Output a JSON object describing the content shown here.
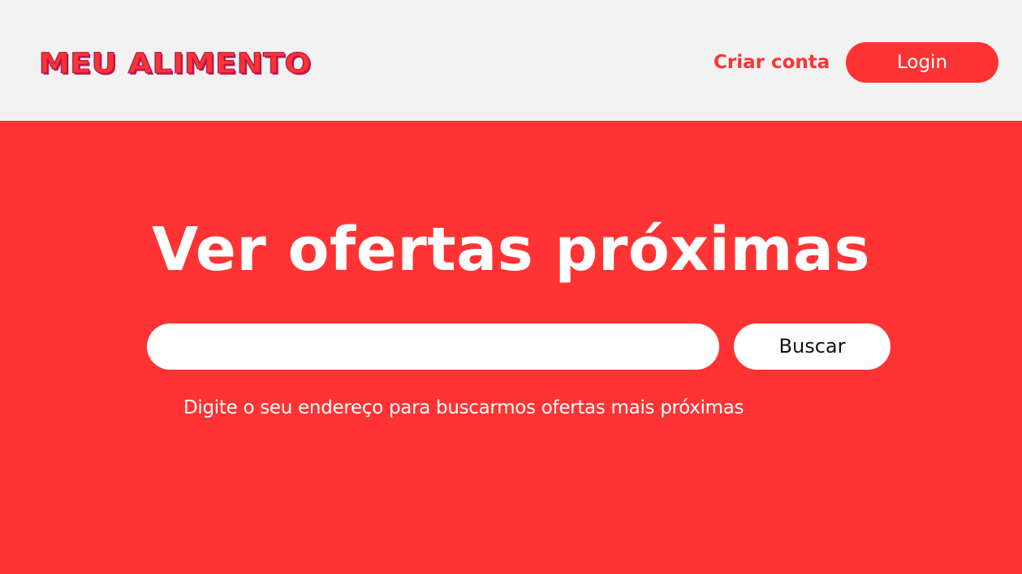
{
  "header": {
    "logo_text": "MEU ALIMENTO",
    "signup_label": "Criar conta",
    "login_label": "Login"
  },
  "hero": {
    "headline": "Ver ofertas próximas",
    "search": {
      "value": "",
      "placeholder": ""
    },
    "search_button_label": "Buscar",
    "helper_text": "Digite o seu endereço para buscarmos ofertas mais próximas"
  },
  "colors": {
    "brand_red": "#ff3333",
    "header_bg": "#f2f2f2",
    "white": "#ffffff"
  }
}
